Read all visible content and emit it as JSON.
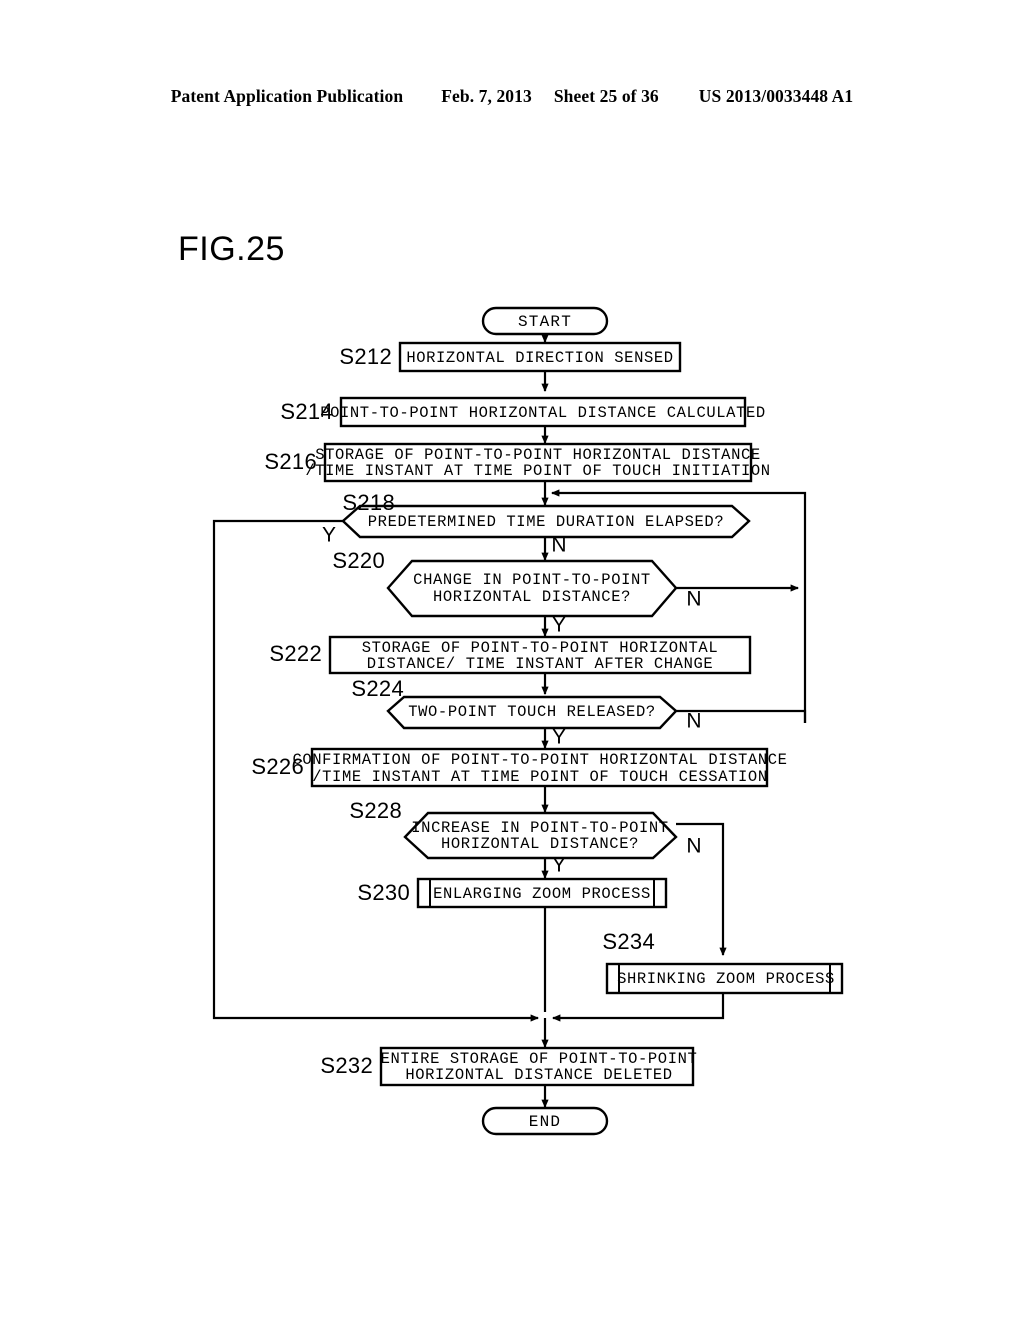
{
  "header": {
    "publication": "Patent Application Publication",
    "date": "Feb. 7, 2013",
    "sheet": "Sheet 25 of 36",
    "number": "US 2013/0033448 A1"
  },
  "figure": {
    "title": "FIG.25"
  },
  "flowchart": {
    "start_label": "START",
    "end_label": "END",
    "yes_label": "Y",
    "no_label": "N",
    "steps": [
      {
        "id": "S212",
        "text": "HORIZONTAL DIRECTION SENSED",
        "type": "process"
      },
      {
        "id": "S214",
        "text": "POINT-TO-POINT HORIZONTAL DISTANCE CALCULATED",
        "type": "process"
      },
      {
        "id": "S216",
        "line1": "STORAGE OF POINT-TO-POINT HORIZONTAL DISTANCE",
        "line2": "/TIME INSTANT AT TIME POINT OF TOUCH INITIATION",
        "type": "process"
      },
      {
        "id": "S218",
        "text": "PREDETERMINED TIME DURATION ELAPSED?",
        "type": "decision"
      },
      {
        "id": "S220",
        "line1": "CHANGE IN POINT-TO-POINT",
        "line2": "HORIZONTAL DISTANCE?",
        "type": "decision"
      },
      {
        "id": "S222",
        "line1": "STORAGE OF POINT-TO-POINT HORIZONTAL",
        "line2": "DISTANCE/ TIME INSTANT AFTER CHANGE",
        "type": "process"
      },
      {
        "id": "S224",
        "text": "TWO-POINT TOUCH RELEASED?",
        "type": "decision"
      },
      {
        "id": "S226",
        "line1": "CONFIRMATION OF POINT-TO-POINT HORIZONTAL DISTANCE",
        "line2": "/TIME INSTANT AT TIME POINT OF TOUCH CESSATION",
        "type": "process"
      },
      {
        "id": "S228",
        "line1": "INCREASE IN POINT-TO-POINT",
        "line2": "HORIZONTAL DISTANCE?",
        "type": "decision"
      },
      {
        "id": "S230",
        "text": "ENLARGING ZOOM PROCESS",
        "type": "predefined"
      },
      {
        "id": "S234",
        "text": "SHRINKING ZOOM PROCESS",
        "type": "predefined"
      },
      {
        "id": "S232",
        "line1": "ENTIRE STORAGE OF POINT-TO-POINT",
        "line2": "HORIZONTAL DISTANCE DELETED",
        "type": "process"
      }
    ]
  }
}
